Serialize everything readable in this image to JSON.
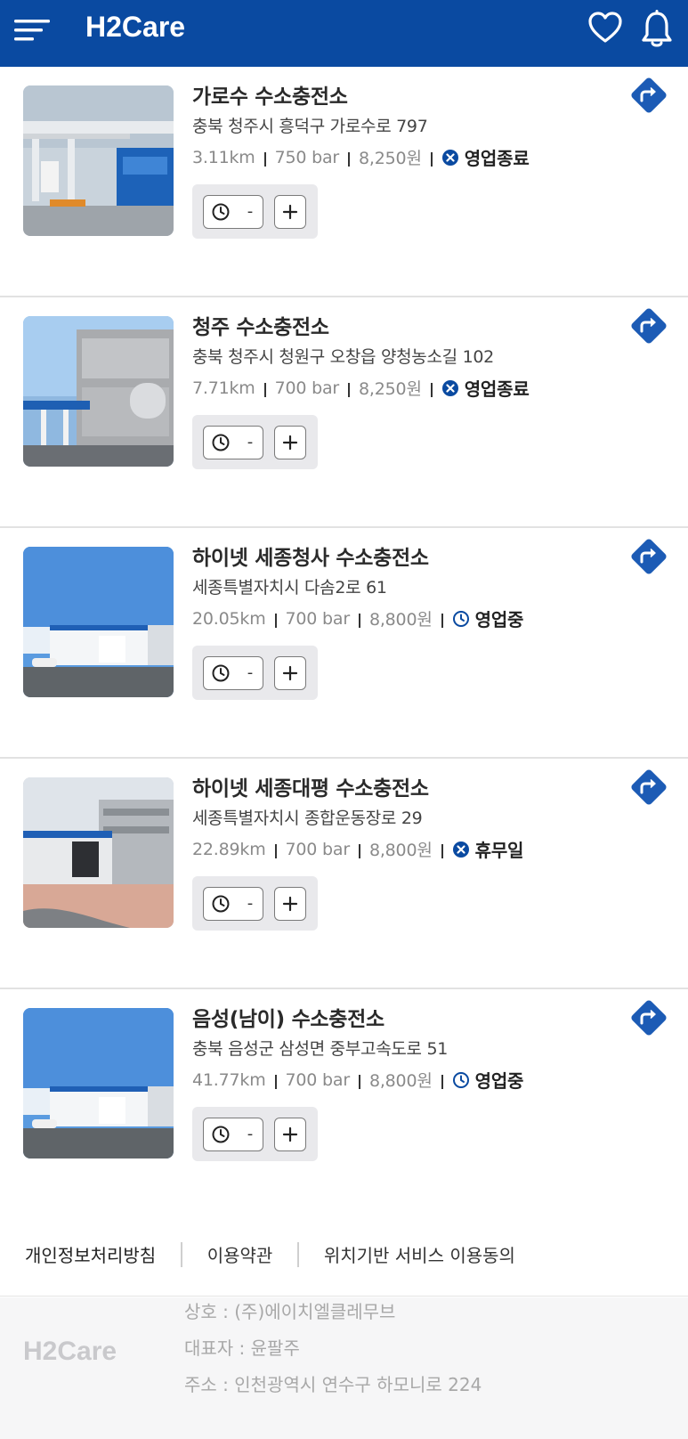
{
  "header": {
    "logo_text": "H2Care",
    "brand_color": "#0A4AA1",
    "icons": [
      "menu-icon",
      "heart-icon",
      "bell-icon"
    ]
  },
  "stations": [
    {
      "name": "가로수 수소충전소",
      "address": "충북 청주시 흥덕구 가로수로 797",
      "distance": "3.11km",
      "pressure": "750 bar",
      "price": "8,250원",
      "status": "영업종료",
      "status_icon": "closed-x-icon"
    },
    {
      "name": "청주 수소충전소",
      "address": "충북 청주시 청원구 오창읍 양청농소길 102",
      "distance": "7.71km",
      "pressure": "700 bar",
      "price": "8,250원",
      "status": "영업종료",
      "status_icon": "closed-x-icon"
    },
    {
      "name": "하이넷 세종청사 수소충전소",
      "address": "세종특별자치시 다솜2로 61",
      "distance": "20.05km",
      "pressure": "700 bar",
      "price": "8,800원",
      "status": "영업중",
      "status_icon": "clock-icon"
    },
    {
      "name": "하이넷 세종대평 수소충전소",
      "address": "세종특별자치시 종합운동장로 29",
      "distance": "22.89km",
      "pressure": "700 bar",
      "price": "8,800원",
      "status": "휴무일",
      "status_icon": "closed-x-icon"
    },
    {
      "name": "음성(남이) 수소충전소",
      "address": "충북 음성군 삼성면 중부고속도로 51",
      "distance": "41.77km",
      "pressure": "700 bar",
      "price": "8,800원",
      "status": "영업중",
      "status_icon": "clock-icon"
    }
  ],
  "time_control": {
    "minus": "-",
    "plus": "+"
  },
  "footer": {
    "links": [
      "개인정보처리방침",
      "이용약관",
      "위치기반 서비스 이용동의"
    ],
    "logo_text": "H2Care",
    "company": "상호 : (주)에이치엘클레무브",
    "ceo": "대표자 : 윤팔주",
    "address": "주소 : 인천광역시 연수구 하모니로 224"
  }
}
